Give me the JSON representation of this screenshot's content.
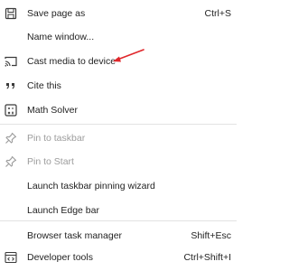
{
  "menu": {
    "items": [
      {
        "label": "Save page as",
        "shortcut": "Ctrl+S",
        "icon": "save-icon"
      },
      {
        "label": "Name window...",
        "shortcut": "",
        "icon": ""
      },
      {
        "label": "Cast media to device",
        "shortcut": "",
        "icon": "cast-icon"
      },
      {
        "label": "Cite this",
        "shortcut": "",
        "icon": "quote-icon"
      },
      {
        "label": "Math Solver",
        "shortcut": "",
        "icon": "math-solver-icon"
      },
      {
        "label": "Pin to taskbar",
        "shortcut": "",
        "icon": "pin-icon",
        "disabled": true
      },
      {
        "label": "Pin to Start",
        "shortcut": "",
        "icon": "pin-icon",
        "disabled": true
      },
      {
        "label": "Launch taskbar pinning wizard",
        "shortcut": "",
        "icon": ""
      },
      {
        "label": "Launch Edge bar",
        "shortcut": "",
        "icon": ""
      },
      {
        "label": "Browser task manager",
        "shortcut": "Shift+Esc",
        "icon": ""
      },
      {
        "label": "Developer tools",
        "shortcut": "Ctrl+Shift+I",
        "icon": "developer-tools-icon"
      }
    ]
  },
  "annotation": {
    "arrow_color": "#e0272b"
  }
}
